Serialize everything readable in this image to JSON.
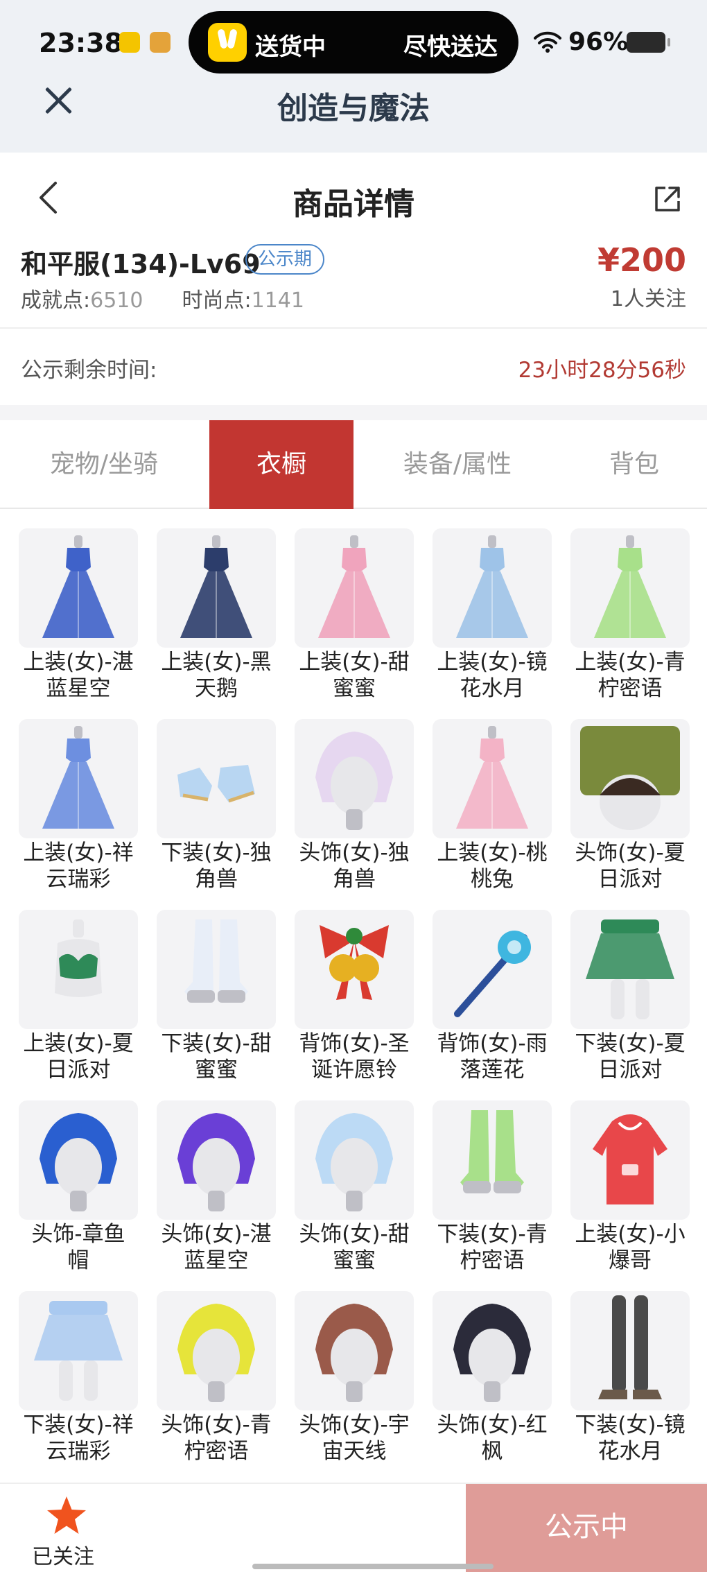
{
  "status_bar": {
    "time": "23:38",
    "island_left": "送货中",
    "island_right": "尽快送达",
    "battery": "96%"
  },
  "app": {
    "title": "创造与魔法"
  },
  "header": {
    "title": "商品详情"
  },
  "product": {
    "name": "和平服(134)-Lv69",
    "badge": "公示期",
    "achievement_label": "成就点:",
    "achievement_value": "6510",
    "fashion_label": "时尚点:",
    "fashion_value": "1141",
    "price": "¥200",
    "followers": "1人关注"
  },
  "countdown": {
    "label": "公示剩余时间:",
    "value": "23小时28分56秒"
  },
  "tabs": [
    "宠物/坐骑",
    "衣橱",
    "装备/属性",
    "背包"
  ],
  "active_tab": "衣橱",
  "items": [
    {
      "line1": "上装(女)-湛",
      "line2": "蓝星空",
      "icon": "dress-icon",
      "color": "#3f62c9"
    },
    {
      "line1": "上装(女)-黑",
      "line2": "天鹅",
      "icon": "dress-icon",
      "color": "#2c3d6b"
    },
    {
      "line1": "上装(女)-甜",
      "line2": "蜜蜜",
      "icon": "dress-icon",
      "color": "#f0a4bd"
    },
    {
      "line1": "上装(女)-镜",
      "line2": "花水月",
      "icon": "dress-icon",
      "color": "#9ec3e8"
    },
    {
      "line1": "上装(女)-青",
      "line2": "柠密语",
      "icon": "dress-icon",
      "color": "#a8e08a"
    },
    {
      "line1": "上装(女)-祥",
      "line2": "云瑞彩",
      "icon": "dress-icon",
      "color": "#6d8fe0"
    },
    {
      "line1": "下装(女)-独",
      "line2": "角兽",
      "icon": "shoes-icon",
      "color": "#b8d6f2"
    },
    {
      "line1": "头饰(女)-独",
      "line2": "角兽",
      "icon": "head-icon",
      "color": "#e6d7f0"
    },
    {
      "line1": "上装(女)-桃",
      "line2": "桃兔",
      "icon": "dress-icon",
      "color": "#f3b3c6"
    },
    {
      "line1": "头饰(女)-夏",
      "line2": "日派对",
      "icon": "hat-icon",
      "color": "#7a8a3c"
    },
    {
      "line1": "上装(女)-夏",
      "line2": "日派对",
      "icon": "top-icon",
      "color": "#2e8a58"
    },
    {
      "line1": "下装(女)-甜",
      "line2": "蜜蜜",
      "icon": "boots-icon",
      "color": "#e8eef8"
    },
    {
      "line1": "背饰(女)-圣",
      "line2": "诞许愿铃",
      "icon": "bell-icon",
      "color": "#d93a2f"
    },
    {
      "line1": "背饰(女)-雨",
      "line2": "落莲花",
      "icon": "staff-icon",
      "color": "#3fb6e0"
    },
    {
      "line1": "下装(女)-夏",
      "line2": "日派对",
      "icon": "skirt-icon",
      "color": "#2e8a58"
    },
    {
      "line1": "头饰-章鱼",
      "line2": "帽",
      "icon": "head-icon",
      "color": "#2a5fd0"
    },
    {
      "line1": "头饰(女)-湛",
      "line2": "蓝星空",
      "icon": "head-icon",
      "color": "#6a3fd6"
    },
    {
      "line1": "头饰(女)-甜",
      "line2": "蜜蜜",
      "icon": "head-icon",
      "color": "#bcdaf5"
    },
    {
      "line1": "下装(女)-青",
      "line2": "柠密语",
      "icon": "boots-icon",
      "color": "#a8e08a"
    },
    {
      "line1": "上装(女)-小",
      "line2": "爆哥",
      "icon": "hoodie-icon",
      "color": "#e8474a"
    },
    {
      "line1": "下装(女)-祥",
      "line2": "云瑞彩",
      "icon": "skirt-icon",
      "color": "#a9c9f0"
    },
    {
      "line1": "头饰(女)-青",
      "line2": "柠密语",
      "icon": "head-icon",
      "color": "#e6e43a"
    },
    {
      "line1": "头饰(女)-宇",
      "line2": "宙天线",
      "icon": "head-icon",
      "color": "#9a5a4a"
    },
    {
      "line1": "头饰(女)-红",
      "line2": "枫",
      "icon": "head-icon",
      "color": "#2b2b3a"
    },
    {
      "line1": "下装(女)-镜",
      "line2": "花水月",
      "icon": "legs-icon",
      "color": "#4a4a4a"
    }
  ],
  "bottom": {
    "follow_label": "已关注",
    "action_label": "公示中"
  },
  "colors": {
    "accent": "#c23631",
    "price": "#c03b33",
    "badge": "#4b86c9",
    "star": "#f0531e",
    "action": "#df9c98"
  }
}
